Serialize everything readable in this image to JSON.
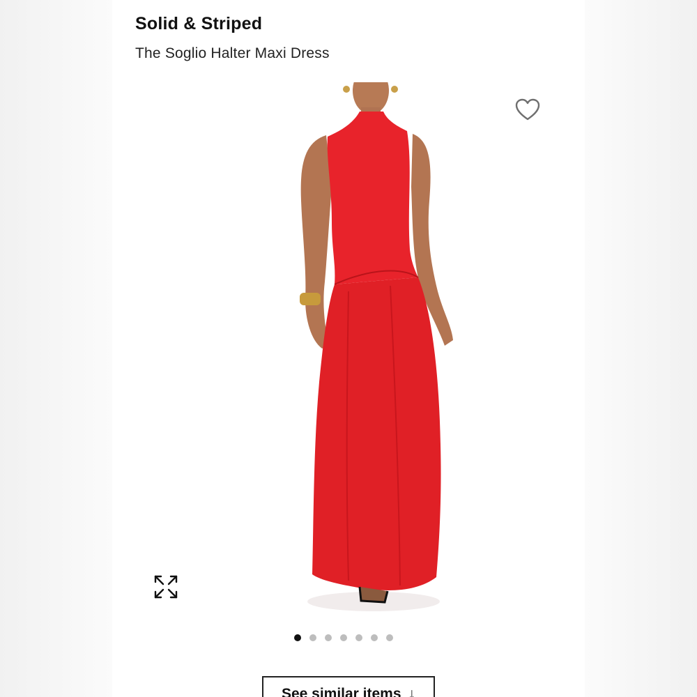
{
  "header": {
    "brand": "Solid & Striped",
    "product_name": "The Soglio Halter Maxi Dress"
  },
  "gallery": {
    "image_subject": "model-in-red-halter-maxi-dress",
    "dress_color": "#e8232b",
    "total_images": 7,
    "current_index": 1
  },
  "icons": {
    "wishlist": "heart-icon",
    "expand": "expand-arrows-icon",
    "arrow": "arrow-down-icon"
  },
  "actions": {
    "see_similar_label": "See similar items",
    "see_similar_arrow": "↓"
  }
}
